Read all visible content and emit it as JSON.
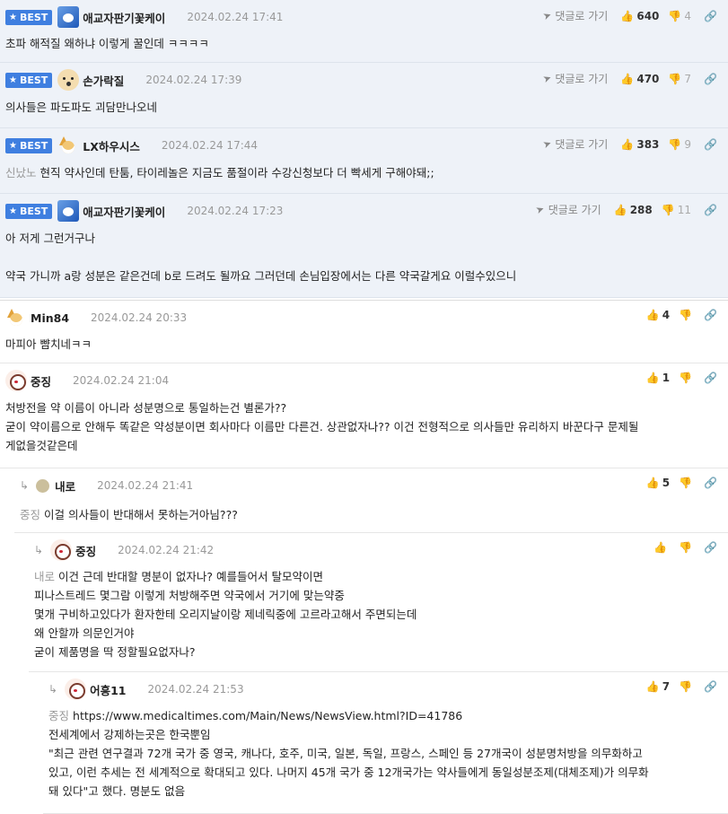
{
  "labels": {
    "best": "BEST",
    "reply_link": "댓글로 가기"
  },
  "comments": [
    {
      "nick": "애교자판기꽃케이",
      "date": "2024.02.24 17:41",
      "up": "640",
      "down": "4",
      "mention": "",
      "lines": [
        "초파 해적질 왜하냐 이렇게 꿀인데 ㅋㅋㅋㅋ"
      ]
    },
    {
      "nick": "손가락질",
      "date": "2024.02.24 17:39",
      "up": "470",
      "down": "7",
      "mention": "",
      "lines": [
        "의사들은 파도파도 괴담만나오네"
      ]
    },
    {
      "nick": "LX하우시스",
      "date": "2024.02.24 17:44",
      "up": "383",
      "down": "9",
      "mention": "신났노",
      "lines": [
        "현직 약사인데 탄툼, 타이레놀은 지금도 품절이라 수강신청보다 더 빡세게 구해야돼;;"
      ]
    },
    {
      "nick": "애교자판기꽃케이",
      "date": "2024.02.24 17:23",
      "up": "288",
      "down": "11",
      "mention": "",
      "lines": [
        "아 저게 그런거구나",
        "",
        "약국 가니까 a랑 성분은 같은건데 b로 드려도 될까요 그러던데 손님입장에서는 다른 약국갈게요 이럴수있으니"
      ]
    },
    {
      "nick": "Min84",
      "date": "2024.02.24 20:33",
      "up": "4",
      "mention": "",
      "lines": [
        "마피아 뺨치네ㅋㅋ"
      ]
    },
    {
      "nick": "중징",
      "date": "2024.02.24 21:04",
      "up": "1",
      "mention": "",
      "lines": [
        "처방전을 약 이름이 아니라 성분명으로 통일하는건 별론가??",
        "굳이 약이름으로 안해두 똑같은 약성분이면 회사마다 이름만 다른건. 상관없자나?? 이건 전형적으로 의사들만 유리하지 바꾼다구 문제될",
        "게없을것같은데"
      ]
    },
    {
      "nick": "내로",
      "date": "2024.02.24 21:41",
      "up": "5",
      "mention": "중징",
      "lines": [
        "이걸 의사들이 반대해서 못하는거아님???"
      ]
    },
    {
      "nick": "중징",
      "date": "2024.02.24 21:42",
      "up": "",
      "mention": "내로",
      "lines": [
        "이건 근데 반대할 명분이 없자나? 예를들어서 탈모약이면",
        "피나스트레드 몇그람 이렇게 처방해주면 약국에서 거기에 맞는약중",
        "몇개 구비하고있다가 환자한테 오리지날이랑 제네릭중에 고르라고해서 주면되는데",
        "왜 안할까 의문인거야",
        "굳이 제품명을 딱 정할필요없자나?"
      ]
    },
    {
      "nick": "어흥11",
      "date": "2024.02.24 21:53",
      "up": "7",
      "mention": "중징",
      "lines": [
        "https://www.medicaltimes.com/Main/News/NewsView.html?ID=41786",
        "전세계에서 강제하는곳은 한국뿐임",
        "\"최근 관련 연구결과 72개 국가 중 영국, 캐나다, 호주, 미국, 일본, 독일, 프랑스, 스페인 등 27개국이 성분명처방을 의무화하고",
        "있고, 이런 추세는 전 세계적으로 확대되고 있다. 나머지 45개 국가 중 12개국가는 약사들에게 동일성분조제(대체조제)가 의무화",
        "돼 있다\"고 했다. 명분도 없음"
      ]
    }
  ]
}
